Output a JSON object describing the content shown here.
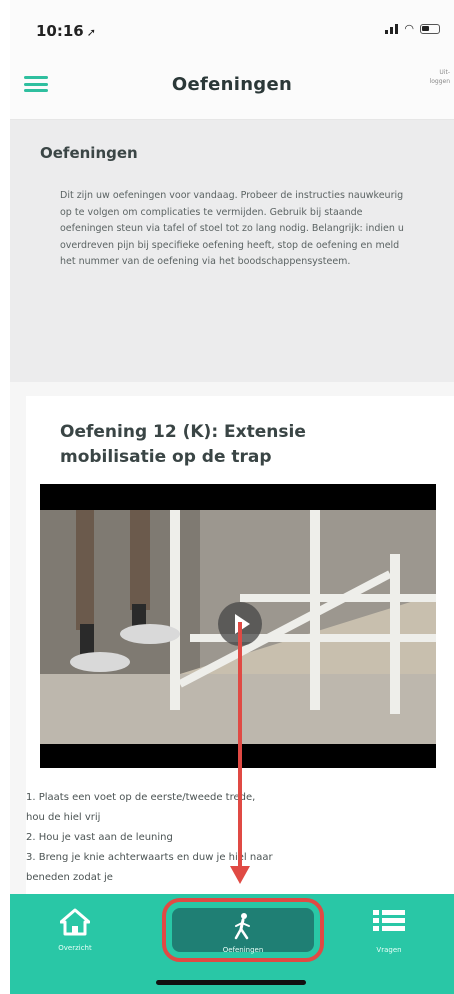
{
  "status_bar": {
    "time": "10:16",
    "location_glyph": "➚"
  },
  "header": {
    "title": "Oefeningen",
    "logout_label": "Uit-\nloggen"
  },
  "intro": {
    "title": "Oefeningen",
    "text": "Dit zijn uw oefeningen voor vandaag. Probeer de instructies nauwkeurig op te volgen om complicaties te vermijden. Gebruik bij staande oefeningen steun via tafel of stoel tot zo lang nodig. Belangrijk: indien u overdreven pijn bij specifieke oefening heeft, stop de oefening en meld het nummer van de oefening via het boodschappensysteem."
  },
  "exercise": {
    "title": "Oefening 12 (K): Extensie mobilisatie op de trap",
    "steps": [
      "1. Plaats een voet op de eerste/tweede trede,",
      "hou de hiel vrij",
      "2. Hou je vast aan de leuning",
      "3. Breng je knie achterwaarts en duw je hiel naar",
      "beneden zodat je"
    ]
  },
  "bottom_nav": {
    "items": [
      {
        "label": "Overzicht",
        "icon": "home-icon",
        "active": false
      },
      {
        "label": "Oefeningen",
        "icon": "walking-person-icon",
        "active": true
      },
      {
        "label": "Vragen",
        "icon": "list-icon",
        "active": false
      }
    ]
  },
  "colors": {
    "accent": "#29c7a6",
    "active_nav": "#1f7f74",
    "highlight": "#e04a44"
  }
}
